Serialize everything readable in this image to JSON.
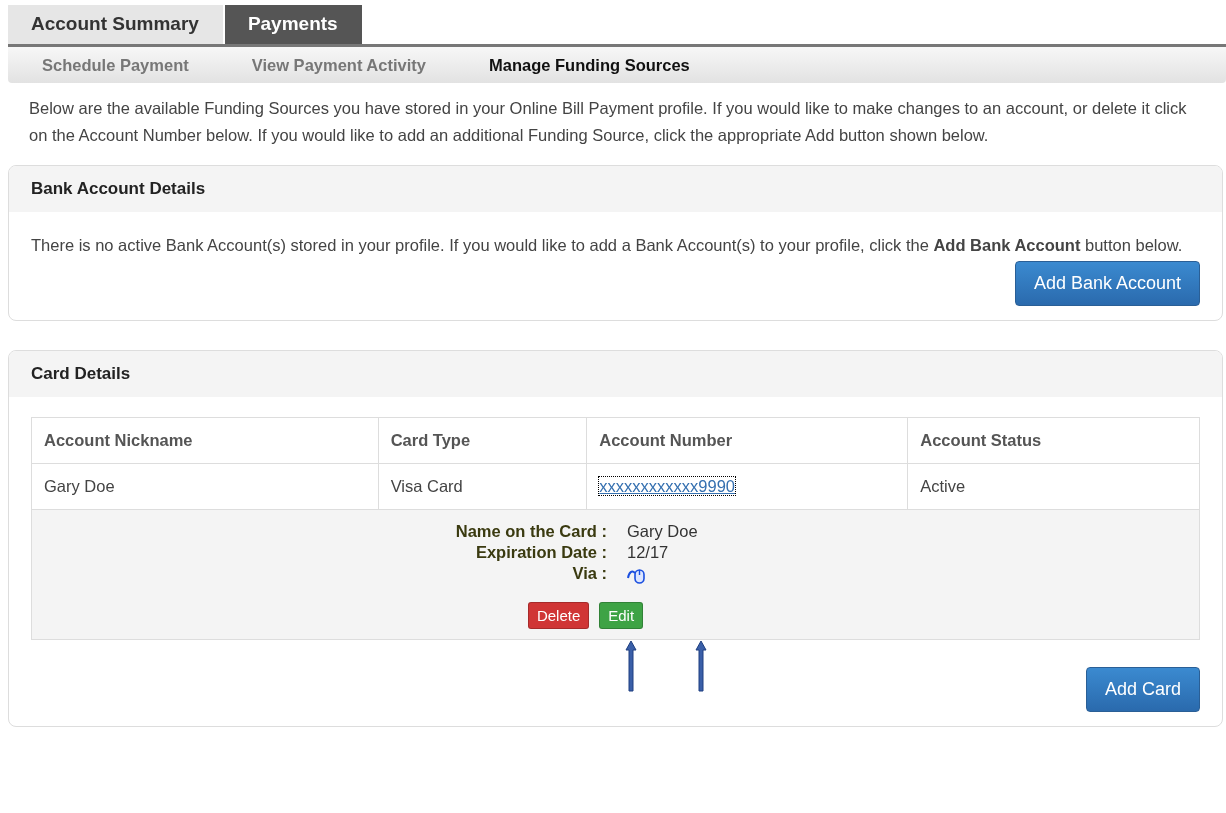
{
  "tabs": [
    {
      "label": "Account Summary",
      "selected": false
    },
    {
      "label": "Payments",
      "selected": true
    }
  ],
  "subnav": [
    {
      "label": "Schedule Payment",
      "selected": false
    },
    {
      "label": "View Payment Activity",
      "selected": false
    },
    {
      "label": "Manage Funding Sources",
      "selected": true
    }
  ],
  "intro": "Below are the available Funding Sources you have stored in your Online Bill Payment profile. If you would like to make changes to an account, or delete it click on the Account Number below. If you would like to add an additional Funding Source, click the appropriate Add button shown below.",
  "bank_panel": {
    "title": "Bank Account Details",
    "message": "There is no active Bank Account(s) stored in your profile. If you would like to add a Bank Account(s) to your profile, click the **Add Bank Account** button below.",
    "button": "Add Bank Account"
  },
  "card_panel": {
    "title": "Card Details",
    "columns": [
      "Account Nickname",
      "Card Type",
      "Account Number",
      "Account Status"
    ],
    "rows": [
      {
        "nickname": "Gary Doe",
        "card_type": "Visa Card",
        "account_number": "xxxxxxxxxxxx9990",
        "status": "Active"
      }
    ],
    "details": [
      {
        "label": "Name on the Card :",
        "value": "Gary Doe",
        "kind": "text"
      },
      {
        "label": "Expiration Date :",
        "value": "12/17",
        "kind": "text"
      },
      {
        "label": "Via :",
        "kind": "icon"
      }
    ],
    "actions": [
      {
        "label": "Delete",
        "kind": "danger"
      },
      {
        "label": "Edit",
        "kind": "success"
      }
    ],
    "button": "Add Card"
  }
}
